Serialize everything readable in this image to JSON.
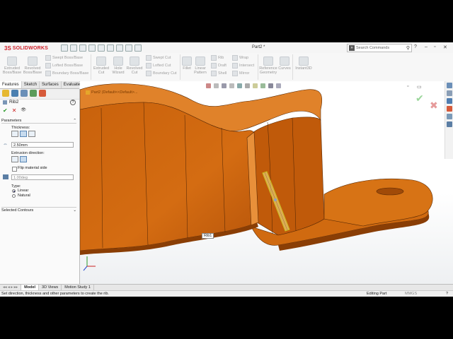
{
  "app": {
    "brand_ds": "3S",
    "brand_name": "SOLIDWORKS",
    "document_title": "Part2 *",
    "search_placeholder": "Search Commands"
  },
  "ribbon": {
    "extruded_boss": "Extruded Boss/Base",
    "revolved_boss": "Revolved Boss/Base",
    "swept_boss": "Swept Boss/Base",
    "lofted_boss": "Lofted Boss/Base",
    "boundary_boss": "Boundary Boss/Base",
    "extruded_cut": "Extruded Cut",
    "hole_wizard": "Hole Wizard",
    "revolved_cut": "Revolved Cut",
    "swept_cut": "Swept Cut",
    "lofted_cut": "Lofted Cut",
    "boundary_cut": "Boundary Cut",
    "fillet": "Fillet",
    "linear_pattern": "Linear Pattern",
    "rib": "Rib",
    "draft": "Draft",
    "shell": "Shell",
    "wrap": "Wrap",
    "intersect": "Intersect",
    "mirror": "Mirror",
    "reference_geometry": "Reference Geometry",
    "curves": "Curves",
    "instant3d": "Instant3D"
  },
  "command_tabs": [
    "Features",
    "Sketch",
    "Surfaces",
    "Evaluate"
  ],
  "property_manager": {
    "title": "Rib2",
    "help": "?",
    "parameters_header": "Parameters",
    "thickness_label": "Thickness:",
    "thickness_value": "2.50mm",
    "extrusion_direction_label": "Extrusion direction:",
    "flip_material_side_label": "Flip material side",
    "draft_angle_value": "1.00deg",
    "type_label": "Type:",
    "type_options": [
      "Linear",
      "Natural"
    ],
    "type_selected": "Linear",
    "selected_contours_header": "Selected Contours"
  },
  "viewport": {
    "tree_flyout": "Part2 (Default<<Default>...",
    "callout": "Rib1"
  },
  "bottom_tabs": [
    "Model",
    "3D Views",
    "Motion Study 1"
  ],
  "status": {
    "message": "Set direction, thickness and other parameters to create the rib.",
    "mode": "Editing Part",
    "units": "MMGS"
  },
  "colors": {
    "part_orange": "#d06a10",
    "part_shadow": "#8a3e05",
    "brand_red": "#d0202a",
    "ok_green": "#2a9a2a",
    "cancel_red": "#cc2222"
  }
}
